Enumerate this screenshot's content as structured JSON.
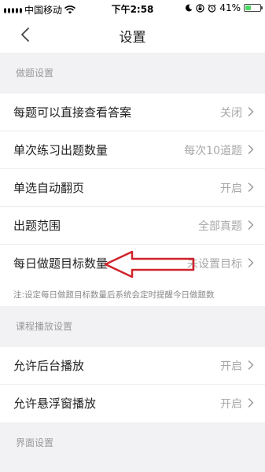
{
  "status_bar": {
    "carrier": "中国移动",
    "time": "下午2:58",
    "battery_percent": "41%",
    "battery_level": 0.41
  },
  "navbar": {
    "title": "设置"
  },
  "sections": {
    "question": {
      "header": "做题设置"
    },
    "course": {
      "header": "课程播放设置"
    },
    "interface": {
      "header": "界面设置"
    }
  },
  "rows": {
    "view_answer": {
      "label": "每题可以直接查看答案",
      "value": "关闭"
    },
    "practice_count": {
      "label": "单次练习出题数量",
      "value": "每次10道题"
    },
    "auto_flip": {
      "label": "单选自动翻页",
      "value": "开启"
    },
    "scope": {
      "label": "出题范围",
      "value": "全部真题"
    },
    "daily_goal": {
      "label": "每日做题目标数量",
      "value": "未设置目标"
    },
    "background_play": {
      "label": "允许后台播放",
      "value": "开启"
    },
    "floating_play": {
      "label": "允许悬浮窗播放",
      "value": "开启"
    }
  },
  "note": "注:设定每日做题目标数量后系统会定时提醒今日做题数",
  "colors": {
    "annotation_arrow": "#d0232a",
    "background": "#f2f2f5",
    "battery_green": "#4cd964"
  }
}
